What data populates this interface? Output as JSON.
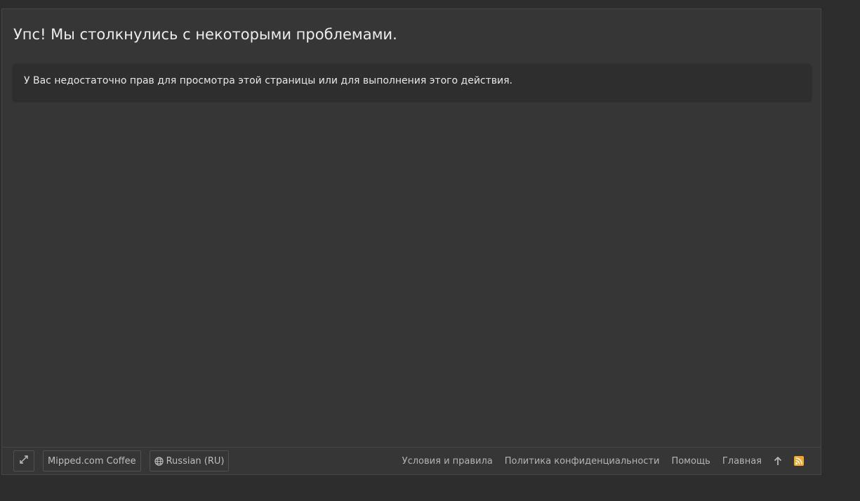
{
  "page": {
    "title": "Упс! Мы столкнулись с некоторыми проблемами.",
    "error_message": "У Вас недостаточно прав для просмотра этой страницы или для выполнения этого действия."
  },
  "footer": {
    "expand_icon": "expand-arrows-icon",
    "style_chooser": "Mipped.com Coffee",
    "language_chooser": "Russian (RU)",
    "language_icon": "globe-icon",
    "links": [
      "Условия и правила",
      "Политика конфиденциальности",
      "Помощь",
      "Главная"
    ],
    "top_icon": "arrow-up-icon",
    "rss_icon": "rss-icon"
  },
  "colors": {
    "background": "#2d2d2d",
    "panel": "#363636",
    "error_block": "#2e2e2e",
    "rss": "#f5a623"
  }
}
